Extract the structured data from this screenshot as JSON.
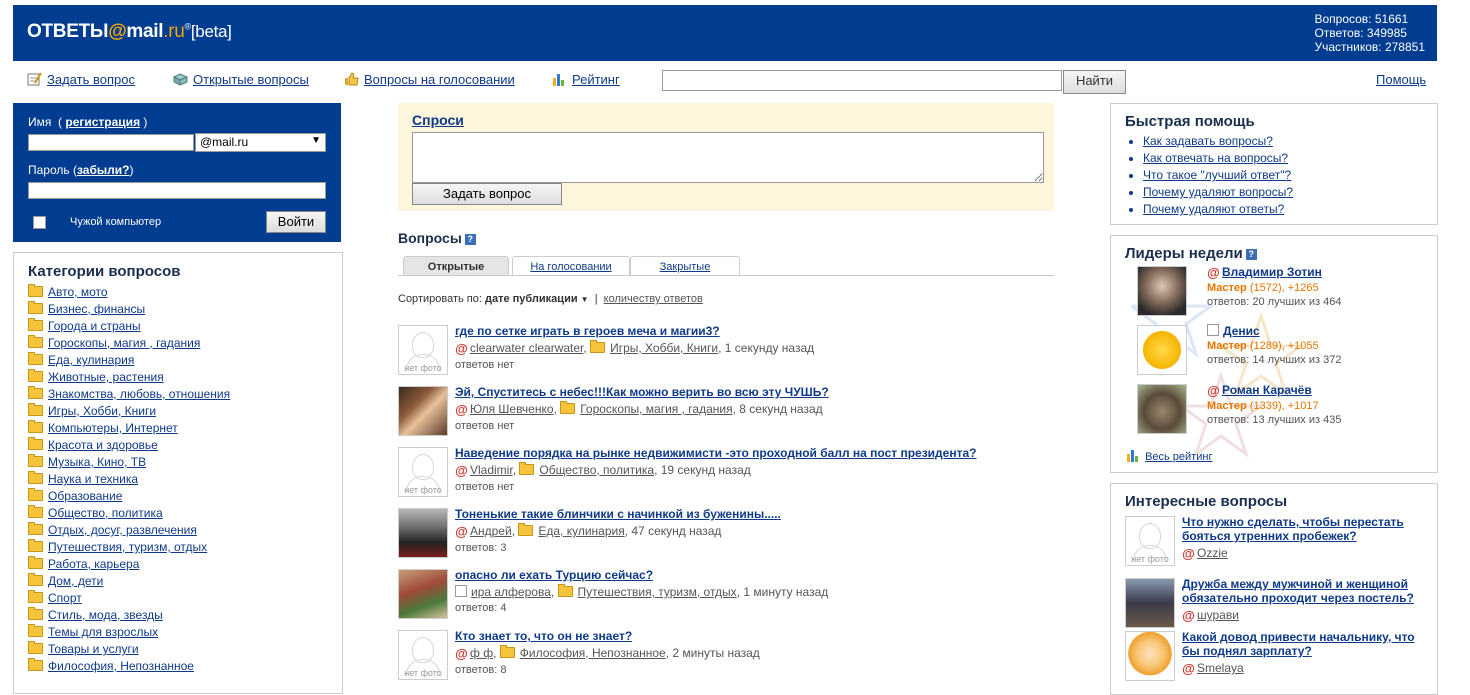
{
  "header": {
    "logo_main": "ОТВЕТЫ",
    "logo_at": "@",
    "logo_mail": "mail",
    "logo_ru": ".ru",
    "logo_reg": "®",
    "logo_beta": "[beta]",
    "stats": [
      "Вопросов: 51661",
      "Ответов: 349985",
      "Участников: 278851"
    ]
  },
  "nav": {
    "ask": "Задать вопрос",
    "open": "Открытые вопросы",
    "voting": "Вопросы на голосовании",
    "rating": "Рейтинг",
    "search_value": "",
    "search_button": "Найти",
    "help": "Помощь"
  },
  "login": {
    "name_label": "Имя",
    "register": "регистрация",
    "domain": "@mail.ru",
    "password_label": "Пароль",
    "forgot": "забыли?",
    "foreign_pc": "Чужой компьютер",
    "login_button": "Войти"
  },
  "categories": {
    "title": "Категории вопросов",
    "items": [
      "Авто, мото",
      "Бизнес, финансы",
      "Города и страны",
      "Гороскопы, магия , гадания",
      "Еда, кулинария",
      "Животные, растения",
      "Знакомства, любовь, отношения",
      "Игры, Хобби, Книги",
      "Компьютеры, Интернет",
      "Красота и здоровье",
      "Музыка, Кино, ТВ",
      "Наука и техника",
      "Образование",
      "Общество, политика",
      "Отдых, досуг, развлечения",
      "Путешествия, туризм, отдых",
      "Работа, карьера",
      "Дом, дети",
      "Спорт",
      "Стиль, мода, звезды",
      "Темы для взрослых",
      "Товары и услуги",
      "Философия, Непознанное"
    ]
  },
  "ask": {
    "title": "Спроси",
    "textarea_value": "",
    "button": "Задать вопрос"
  },
  "questions": {
    "title": "Вопросы",
    "help_mark": "?",
    "tabs": [
      "Открытые",
      "На голосовании",
      "Закрытые"
    ],
    "sort_label": "Сортировать по:",
    "sort_active": "дате публикации",
    "sort_other": "количеству ответов",
    "no_photo": "нет фото",
    "items": [
      {
        "title": "где по сетке играть в героев меча и магии3?",
        "user": "clearwater clearwater",
        "category": "Игры, Хобби, Книги",
        "time": ", 1 секунду назад",
        "answers": "ответов нет",
        "photo": "none",
        "mail": true
      },
      {
        "title": "Эй, Спуститесь с небес!!!Как можно верить во всю эту ЧУШЬ?",
        "user": "Юля Шевченко",
        "category": "Гороскопы, магия , гадания",
        "time": ", 8 секунд назад",
        "answers": "ответов нет",
        "photo": "woman",
        "mail": true
      },
      {
        "title": "Наведение порядка на рынке недвижимисти -это проходной балл на пост президента?",
        "user": "Vladimir",
        "category": "Общество, политика",
        "time": ", 19 секунд назад",
        "answers": "ответов нет",
        "photo": "none",
        "mail": true
      },
      {
        "title": "Тоненькие такие блинчики с начинкой из буженины.....",
        "user": "Андрей",
        "category": "Еда, кулинария",
        "time": ", 47 секунд назад",
        "answers": "ответов: 3",
        "photo": "man",
        "mail": true
      },
      {
        "title": "опасно ли ехать Турцию сейчас?",
        "user": "ира алферова",
        "category": "Путешествия, туризм, отдых",
        "time": ", 1 минуту назад",
        "answers": "ответов: 4",
        "photo": "flowers",
        "mail": false
      },
      {
        "title": "Кто знает то, что он не знает?",
        "user": "ф ф",
        "category": "Философия, Непознанное",
        "time": ", 2 минуты назад",
        "answers": "ответов: 8",
        "photo": "none",
        "mail": true
      }
    ]
  },
  "quick_help": {
    "title": "Быстрая помощь",
    "items": [
      "Как задавать вопросы?",
      "Как отвечать на вопросы?",
      "Что такое \"лучший ответ\"?",
      "Почему удаляют вопросы?",
      "Почему удаляют ответы?"
    ]
  },
  "leaders": {
    "title": "Лидеры недели",
    "items": [
      {
        "name": "Владимир Зотин",
        "rank": "Мастер",
        "points": " (1572), +1265",
        "best": "ответов: 20 лучших из 464",
        "mail": true
      },
      {
        "name": "Денис",
        "rank": "Мастер",
        "points": " (1289), +1055",
        "best": "ответов: 14 лучших из 372",
        "mail": false
      },
      {
        "name": "Роман Карачёв",
        "rank": "Мастер",
        "points": " (1339), +1017",
        "best": "ответов: 13 лучших из 435",
        "mail": true
      }
    ],
    "all_rating": "Весь рейтинг"
  },
  "interesting": {
    "title": "Интересные вопросы",
    "items": [
      {
        "title1": "Что нужно сделать, чтобы перестать",
        "title2": "бояться утренних пробежек?",
        "user": "Ozzie"
      },
      {
        "title1": "Дружба между мужчиной и женщиной",
        "title2": "обязательно проходит через постель?",
        "user": "шурави"
      },
      {
        "title1": "Какой довод привести начальнику, что",
        "title2": "бы поднял зарплату?",
        "user": "Smelaya"
      }
    ]
  },
  "colors": {
    "brand_blue": "#003c8f",
    "link": "#0f3a8a",
    "orange": "#e87400",
    "ask_bg": "#fdf5dc"
  }
}
